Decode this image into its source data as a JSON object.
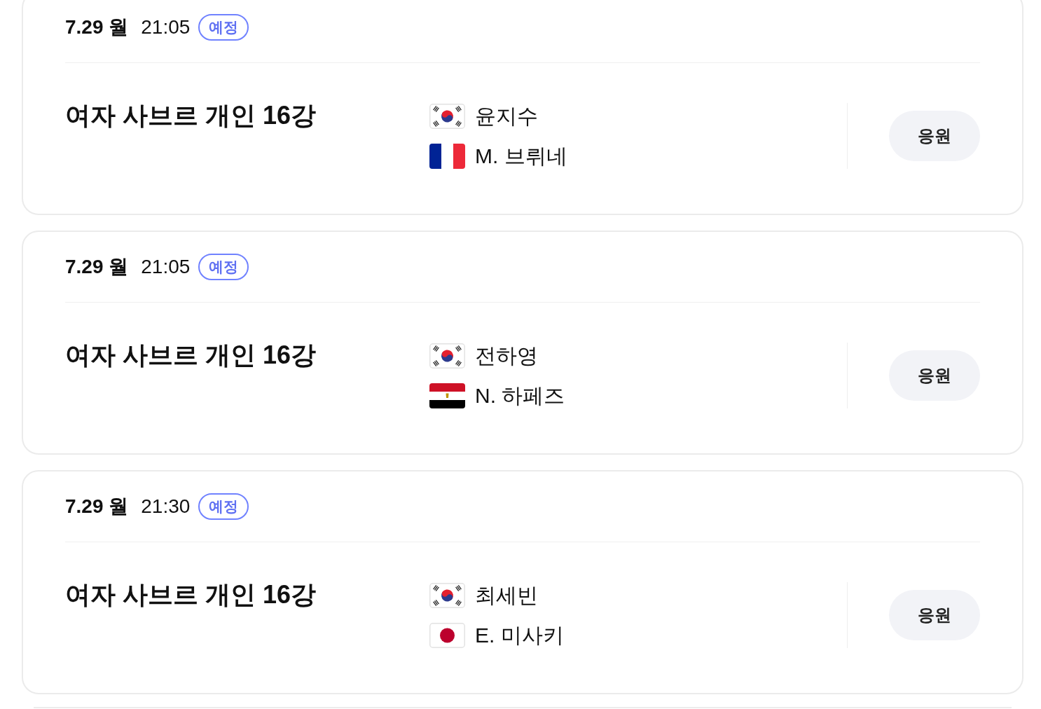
{
  "matches": [
    {
      "date": "7.29 월",
      "time": "21:05",
      "status": "예정",
      "event": "여자 사브르 개인 16강",
      "players": [
        {
          "kind": "korea",
          "name": "윤지수"
        },
        {
          "kind": "france",
          "name": "M. 브뤼네"
        }
      ],
      "button": "응원"
    },
    {
      "date": "7.29 월",
      "time": "21:05",
      "status": "예정",
      "event": "여자 사브르 개인 16강",
      "players": [
        {
          "kind": "korea",
          "name": "전하영"
        },
        {
          "kind": "egypt",
          "name": "N. 하페즈"
        }
      ],
      "button": "응원"
    },
    {
      "date": "7.29 월",
      "time": "21:30",
      "status": "예정",
      "event": "여자 사브르 개인 16강",
      "players": [
        {
          "kind": "korea",
          "name": "최세빈"
        },
        {
          "kind": "japan",
          "name": "E. 미사키"
        }
      ],
      "button": "응원"
    }
  ]
}
